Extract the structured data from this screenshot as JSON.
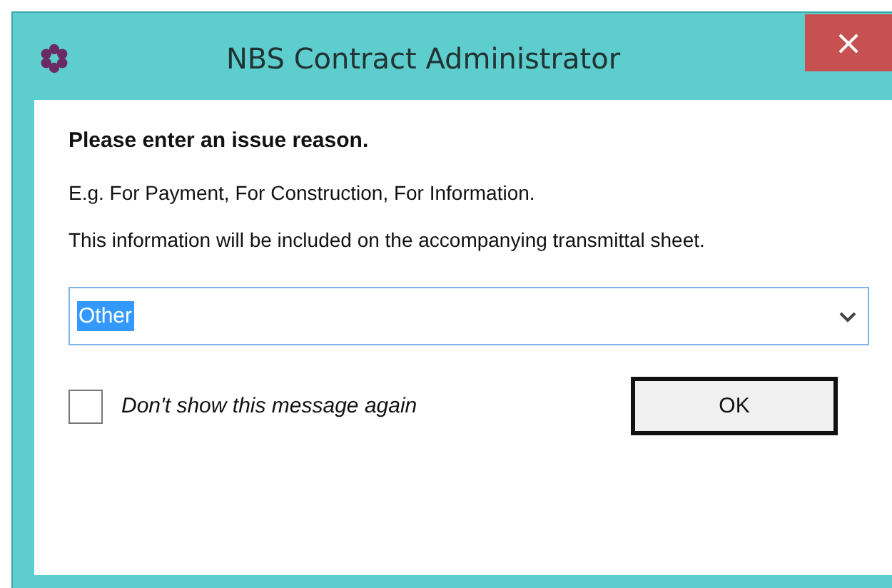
{
  "window": {
    "title": "NBS Contract Administrator",
    "close": "×"
  },
  "heading": "Please enter an issue reason.",
  "example": "E.g. For Payment, For Construction, For Information.",
  "info": "This information will be included on the accompanying transmittal sheet.",
  "combo": {
    "value": "Other",
    "text_selected": true
  },
  "checkbox": {
    "label": "Don't show this message again",
    "checked": false
  },
  "buttons": [
    {
      "label": "OK",
      "default": true
    }
  ]
}
